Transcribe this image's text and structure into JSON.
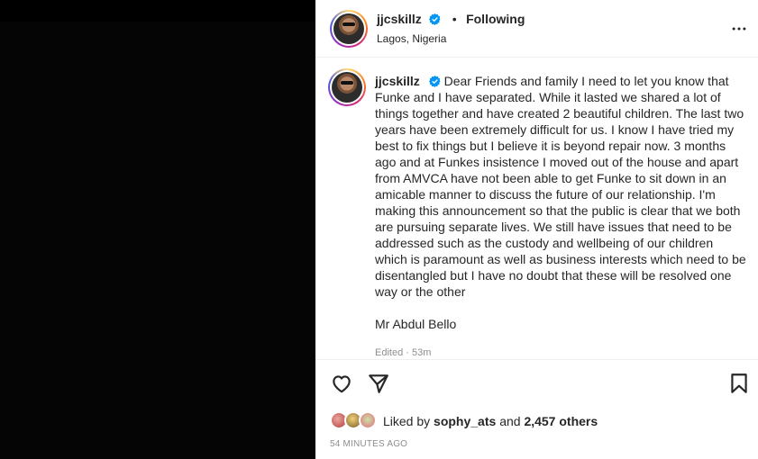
{
  "post": {
    "username": "jjcskillz",
    "dot": "•",
    "follow_status": "Following",
    "location": "Lagos, Nigeria",
    "more_icon": "more-horizontal-icon"
  },
  "caption": {
    "username": "jjcskillz",
    "text": "Dear Friends and family I need to let you know that Funke and I have separated. While it lasted we shared a lot of things together and have created 2 beautiful children. The last two years have been extremely difficult for us. I know I have tried my best to fix things but I believe it is beyond repair now. 3 months ago and at Funkes insistence I moved out of the house and apart from AMVCA have not been able to get Funke to sit down in an amicable manner to discuss the future of our relationship. I'm making this announcement so that the public is clear that we both are pursuing separate lives. We still have issues that need to be addressed such as the custody and wellbeing of our children which is paramount as well as business interests which need to be disentangled but I have no doubt that these will be resolved one way or the other",
    "signature": "Mr Abdul Bello",
    "edited": "Edited · 53m"
  },
  "engagement": {
    "liked_by_prefix": "Liked by",
    "liked_by_user": "sophy_ats",
    "and_word": "and",
    "others_count": "2,457 others",
    "timestamp": "54 minutes ago"
  },
  "colors": {
    "verified_blue": "#0095f6",
    "text_primary": "#262626",
    "text_secondary": "#8e8e8e",
    "media_background": "#000000"
  }
}
